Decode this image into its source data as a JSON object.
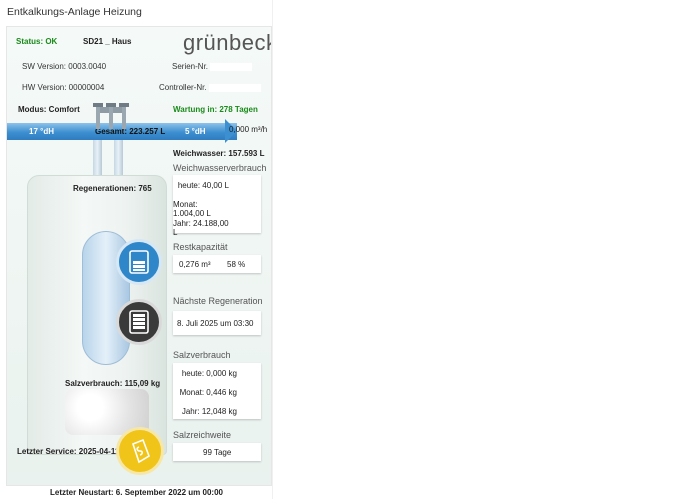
{
  "card": {
    "title": "Entkalkungs-Anlage Heizung"
  },
  "header": {
    "status": "Status: OK",
    "device_name": "SD21 _ Haus",
    "brand": "grünbeck"
  },
  "info": {
    "sw_version": "SW Version: 0003.0040",
    "serial": "Serien-Nr.",
    "hw_version": "HW Version: 00000004",
    "controller": "Controller-Nr."
  },
  "mode": "Modus: Comfort",
  "maintenance": "Wartung in: 278 Tagen",
  "pipe": {
    "hardness_in": "17 °dH",
    "total": "Gesamt: 223.257 L",
    "hardness_out": "5 °dH",
    "flow": "0,000 m³/h"
  },
  "labels": {
    "soft_water": "Weichwasser: 157.593 L",
    "regenerations": "Regenerationen: 765",
    "salt_total": "Salzverbrauch: 115,09 kg",
    "last_service": "Letzter Service: 2025-04-11"
  },
  "soft_water_usage": {
    "title": "Weichwasserverbrauch",
    "today": "heute: 40,00 L",
    "month": "Monat: 1.004,00 L",
    "year": "Jahr: 24.188,00 L"
  },
  "remaining": {
    "title": "Restkapazität",
    "volume": "0,276 m³",
    "percent": "58 %",
    "percent_value": 58
  },
  "next_regen": {
    "title": "Nächste Regeneration",
    "value": "8. Juli 2025 um 03:30"
  },
  "salt_usage": {
    "title": "Salzverbrauch",
    "today": "heute: 0,000 kg",
    "month": "Monat: 0,446 kg",
    "year": "Jahr: 12,048 kg"
  },
  "salt_range": {
    "title": "Salzreichweite",
    "value": "99 Tage"
  },
  "footer": "Letzter Neustart: 6. September 2022 um 00:00",
  "colors": {
    "ok_green": "#1a8a1a",
    "pipe_blue": "#3c8fd0",
    "capacity_blue": "#2f86c8",
    "regen_dark": "#3a3a3a",
    "salt_yellow": "#f0c419"
  }
}
